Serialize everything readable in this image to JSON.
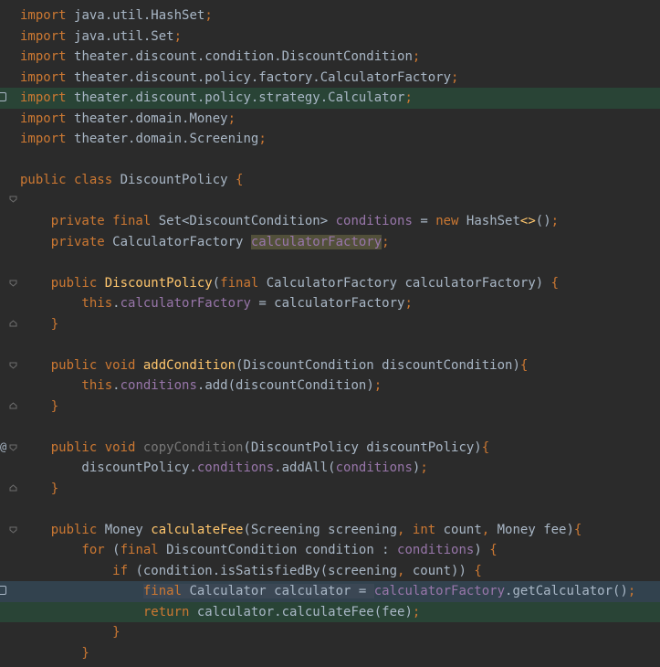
{
  "editor": {
    "lines": [
      {
        "tokens": [
          {
            "t": "import ",
            "c": "kw"
          },
          {
            "t": "java.util.HashSet",
            "c": ""
          },
          {
            "t": ";",
            "c": "kw"
          }
        ]
      },
      {
        "tokens": [
          {
            "t": "import ",
            "c": "kw"
          },
          {
            "t": "java.util.Set",
            "c": ""
          },
          {
            "t": ";",
            "c": "kw"
          }
        ]
      },
      {
        "tokens": [
          {
            "t": "import ",
            "c": "kw"
          },
          {
            "t": "theater.discount.condition.DiscountCondition",
            "c": ""
          },
          {
            "t": ";",
            "c": "kw"
          }
        ]
      },
      {
        "tokens": [
          {
            "t": "import ",
            "c": "kw"
          },
          {
            "t": "theater.discount.policy.factory.CalculatorFactory",
            "c": ""
          },
          {
            "t": ";",
            "c": "kw"
          }
        ]
      },
      {
        "tokens": [
          {
            "t": "import ",
            "c": "kw"
          },
          {
            "t": "theater.discount.policy.strategy.Calculator",
            "c": ""
          },
          {
            "t": ";",
            "c": "kw"
          }
        ]
      },
      {
        "tokens": [
          {
            "t": "import ",
            "c": "kw"
          },
          {
            "t": "theater.domain.Money",
            "c": ""
          },
          {
            "t": ";",
            "c": "kw"
          }
        ]
      },
      {
        "tokens": [
          {
            "t": "import ",
            "c": "kw"
          },
          {
            "t": "theater.domain.Screening",
            "c": ""
          },
          {
            "t": ";",
            "c": "kw"
          }
        ]
      },
      {
        "tokens": []
      },
      {
        "tokens": [
          {
            "t": "public class ",
            "c": "kw"
          },
          {
            "t": "DiscountPolicy ",
            "c": ""
          },
          {
            "t": "{",
            "c": "kw"
          }
        ]
      },
      {
        "tokens": []
      },
      {
        "tokens": [
          {
            "t": "    private final ",
            "c": "kw"
          },
          {
            "t": "Set<DiscountCondition> ",
            "c": ""
          },
          {
            "t": "conditions",
            "c": "field"
          },
          {
            "t": " = ",
            "c": ""
          },
          {
            "t": "new ",
            "c": "kw"
          },
          {
            "t": "HashSet",
            "c": ""
          },
          {
            "t": "<>",
            "c": "fn"
          },
          {
            "t": "()",
            "c": ""
          },
          {
            "t": ";",
            "c": "kw"
          }
        ]
      },
      {
        "tokens": [
          {
            "t": "    private ",
            "c": "kw"
          },
          {
            "t": "CalculatorFactory ",
            "c": ""
          },
          {
            "t": "calculatorFactory",
            "c": "field warnbox"
          },
          {
            "t": ";",
            "c": "kw"
          }
        ]
      },
      {
        "tokens": []
      },
      {
        "tokens": [
          {
            "t": "    public ",
            "c": "kw"
          },
          {
            "t": "DiscountPolicy",
            "c": "fn"
          },
          {
            "t": "(",
            "c": ""
          },
          {
            "t": "final ",
            "c": "kw"
          },
          {
            "t": "CalculatorFactory calculatorFactory) ",
            "c": ""
          },
          {
            "t": "{",
            "c": "kw"
          }
        ]
      },
      {
        "tokens": [
          {
            "t": "        this",
            "c": "kw"
          },
          {
            "t": ".",
            "c": ""
          },
          {
            "t": "calculatorFactory",
            "c": "field"
          },
          {
            "t": " = calculatorFactory",
            "c": ""
          },
          {
            "t": ";",
            "c": "kw"
          }
        ]
      },
      {
        "tokens": [
          {
            "t": "    }",
            "c": "kw"
          }
        ]
      },
      {
        "tokens": []
      },
      {
        "tokens": [
          {
            "t": "    public void ",
            "c": "kw"
          },
          {
            "t": "addCondition",
            "c": "fn"
          },
          {
            "t": "(DiscountCondition discountCondition)",
            "c": ""
          },
          {
            "t": "{",
            "c": "kw"
          }
        ]
      },
      {
        "tokens": [
          {
            "t": "        this",
            "c": "kw"
          },
          {
            "t": ".",
            "c": ""
          },
          {
            "t": "conditions",
            "c": "field"
          },
          {
            "t": ".add(discountCondition)",
            "c": ""
          },
          {
            "t": ";",
            "c": "kw"
          }
        ]
      },
      {
        "tokens": [
          {
            "t": "    }",
            "c": "kw"
          }
        ]
      },
      {
        "tokens": []
      },
      {
        "tokens": [
          {
            "t": "    public void ",
            "c": "kw"
          },
          {
            "t": "copyCondition",
            "c": "dim"
          },
          {
            "t": "(DiscountPolicy discountPolicy)",
            "c": ""
          },
          {
            "t": "{",
            "c": "kw"
          }
        ]
      },
      {
        "tokens": [
          {
            "t": "        discountPolicy.",
            "c": ""
          },
          {
            "t": "conditions",
            "c": "field"
          },
          {
            "t": ".addAll(",
            "c": ""
          },
          {
            "t": "conditions",
            "c": "field"
          },
          {
            "t": ")",
            "c": ""
          },
          {
            "t": ";",
            "c": "kw"
          }
        ]
      },
      {
        "tokens": [
          {
            "t": "    }",
            "c": "kw"
          }
        ]
      },
      {
        "tokens": []
      },
      {
        "tokens": [
          {
            "t": "    public ",
            "c": "kw"
          },
          {
            "t": "Money ",
            "c": ""
          },
          {
            "t": "calculateFee",
            "c": "fn"
          },
          {
            "t": "(Screening screening",
            "c": ""
          },
          {
            "t": ", ",
            "c": "kw"
          },
          {
            "t": "int ",
            "c": "kw"
          },
          {
            "t": "count",
            "c": ""
          },
          {
            "t": ", ",
            "c": "kw"
          },
          {
            "t": "Money fee)",
            "c": ""
          },
          {
            "t": "{",
            "c": "kw"
          }
        ]
      },
      {
        "tokens": [
          {
            "t": "        for ",
            "c": "kw"
          },
          {
            "t": "(",
            "c": ""
          },
          {
            "t": "final ",
            "c": "kw"
          },
          {
            "t": "DiscountCondition condition : ",
            "c": ""
          },
          {
            "t": "conditions",
            "c": "field"
          },
          {
            "t": ") ",
            "c": ""
          },
          {
            "t": "{",
            "c": "kw"
          }
        ]
      },
      {
        "tokens": [
          {
            "t": "            if ",
            "c": "kw"
          },
          {
            "t": "(condition.isSatisfiedBy(screening",
            "c": ""
          },
          {
            "t": ", ",
            "c": "kw"
          },
          {
            "t": "count)) ",
            "c": ""
          },
          {
            "t": "{",
            "c": "kw"
          }
        ]
      },
      {
        "tokens": [
          {
            "t": "                ",
            "c": ""
          },
          {
            "t": "final ",
            "c": "kw sel"
          },
          {
            "t": "Calculator calculator = ",
            "c": "sel"
          },
          {
            "t": "calculatorFactory",
            "c": "field"
          },
          {
            "t": ".getCalculator()",
            "c": ""
          },
          {
            "t": ";",
            "c": "kw"
          }
        ]
      },
      {
        "tokens": [
          {
            "t": "                return ",
            "c": "kw"
          },
          {
            "t": "calculator.calculateFee(fee)",
            "c": ""
          },
          {
            "t": ";",
            "c": "kw"
          }
        ]
      },
      {
        "tokens": [
          {
            "t": "            }",
            "c": "kw"
          }
        ]
      },
      {
        "tokens": [
          {
            "t": "        }",
            "c": "kw"
          }
        ]
      }
    ]
  }
}
